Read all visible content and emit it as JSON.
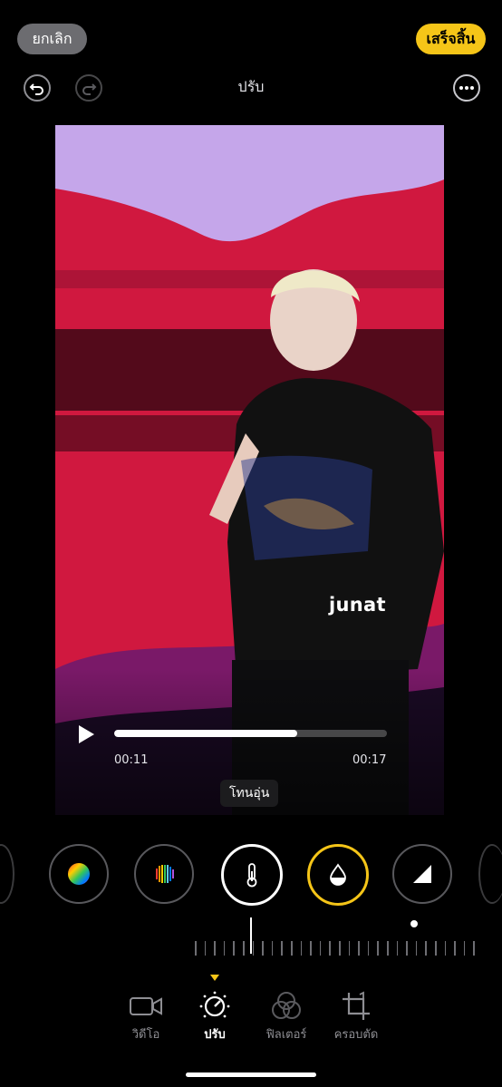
{
  "top_bar": {
    "cancel_label": "ยกเลิก",
    "done_label": "เสร็จสิ้น"
  },
  "toolbar": {
    "title": "ปรับ"
  },
  "photo": {
    "watermark": "junat"
  },
  "player": {
    "current_time": "00:11",
    "end_time": "00:17",
    "progress": 0.67
  },
  "tooltip": "โทนอุ่น",
  "adjustments": [
    "vibrance-icon",
    "color-cast-icon",
    "warmth-icon",
    "tint-icon",
    "sharpness-icon"
  ],
  "tabs": [
    {
      "label": "วิดีโอ",
      "icon": "video-camera-icon"
    },
    {
      "label": "ปรับ",
      "icon": "adjust-dial-icon"
    },
    {
      "label": "ฟิลเตอร์",
      "icon": "filter-icon"
    },
    {
      "label": "ครอบตัด",
      "icon": "crop-icon"
    }
  ],
  "colors": {
    "accent": "#f5c518",
    "cancel_bg": "#6c6c70"
  }
}
